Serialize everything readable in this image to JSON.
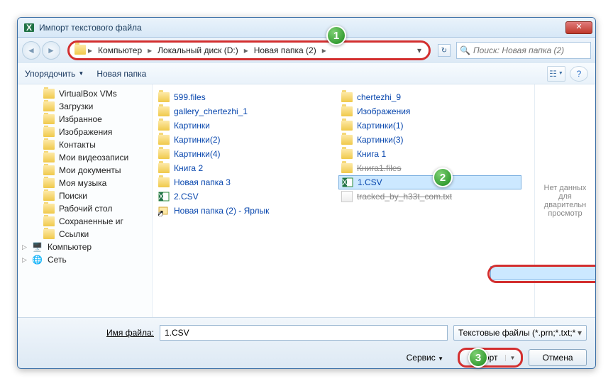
{
  "window": {
    "title": "Импорт текстового файла"
  },
  "breadcrumb": {
    "segments": [
      "Компьютер",
      "Локальный диск (D:)",
      "Новая папка (2)"
    ]
  },
  "search": {
    "placeholder": "Поиск: Новая папка (2)"
  },
  "toolbar": {
    "organize": "Упорядочить",
    "new_folder": "Новая папка"
  },
  "sidebar": {
    "items": [
      {
        "label": "VirtualBox VMs",
        "lvl": 1
      },
      {
        "label": "Загрузки",
        "lvl": 1
      },
      {
        "label": "Избранное",
        "lvl": 1
      },
      {
        "label": "Изображения",
        "lvl": 1
      },
      {
        "label": "Контакты",
        "lvl": 1
      },
      {
        "label": "Мои видеозаписи",
        "lvl": 1
      },
      {
        "label": "Мои документы",
        "lvl": 1
      },
      {
        "label": "Моя музыка",
        "lvl": 1
      },
      {
        "label": "Поиски",
        "lvl": 1
      },
      {
        "label": "Рабочий стол",
        "lvl": 1
      },
      {
        "label": "Сохраненные иг",
        "lvl": 1
      },
      {
        "label": "Ссылки",
        "lvl": 1
      },
      {
        "label": "Компьютер",
        "lvl": 0,
        "icon": "computer"
      },
      {
        "label": "Сеть",
        "lvl": 0,
        "icon": "network"
      }
    ]
  },
  "files": {
    "col1": [
      {
        "name": "599.files",
        "type": "folder"
      },
      {
        "name": "gallery_chertezhi_1",
        "type": "folder"
      },
      {
        "name": "Картинки",
        "type": "folder"
      },
      {
        "name": "Картинки(2)",
        "type": "folder"
      },
      {
        "name": "Картинки(4)",
        "type": "folder"
      },
      {
        "name": "Книга 2",
        "type": "folder"
      },
      {
        "name": "Новая папка 3",
        "type": "folder"
      },
      {
        "name": "2.CSV",
        "type": "csv"
      },
      {
        "name": "Новая папка (2) - Ярлык",
        "type": "shortcut"
      }
    ],
    "col2": [
      {
        "name": "chertezhi_9",
        "type": "folder"
      },
      {
        "name": "Изображения",
        "type": "folder"
      },
      {
        "name": "Картинки(1)",
        "type": "folder"
      },
      {
        "name": "Картинки(3)",
        "type": "folder"
      },
      {
        "name": "Книга 1",
        "type": "folder"
      },
      {
        "name": "Книга1.files",
        "type": "folder",
        "struck": true
      },
      {
        "name": "1.CSV",
        "type": "csv",
        "selected": true
      },
      {
        "name": "tracked_by_h33t_com.txt",
        "type": "txt",
        "struck": true
      }
    ]
  },
  "preview": {
    "text": "Нет данных для дварительн просмотр"
  },
  "footer": {
    "filename_label": "Имя файла:",
    "filename_value": "1.CSV",
    "filetype_label": "Текстовые файлы (*.prn;*.txt;*",
    "service": "Сервис",
    "import": "Импорт",
    "cancel": "Отмена"
  },
  "markers": {
    "m1": "1",
    "m2": "2",
    "m3": "3"
  }
}
